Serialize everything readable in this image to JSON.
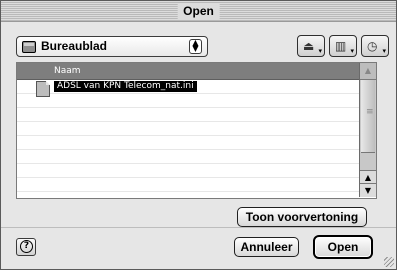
{
  "window": {
    "title": "Open"
  },
  "location_popup": {
    "selected": "Bureaublad",
    "icon": "desktop-icon"
  },
  "toolbar": {
    "buttons": [
      {
        "name": "drive-button",
        "icon": "drive-icon"
      },
      {
        "name": "folders-button",
        "icon": "books-icon"
      },
      {
        "name": "recent-button",
        "icon": "clock-icon"
      }
    ]
  },
  "file_list": {
    "column_header": "Naam",
    "items": [
      {
        "name": "ADSL van KPN Telecom_nat.ini",
        "selected": true,
        "icon": "document-icon"
      }
    ]
  },
  "buttons": {
    "preview": "Toon voorvertoning",
    "cancel": "Annuleer",
    "open": "Open"
  },
  "help": {
    "icon": "help-icon"
  }
}
